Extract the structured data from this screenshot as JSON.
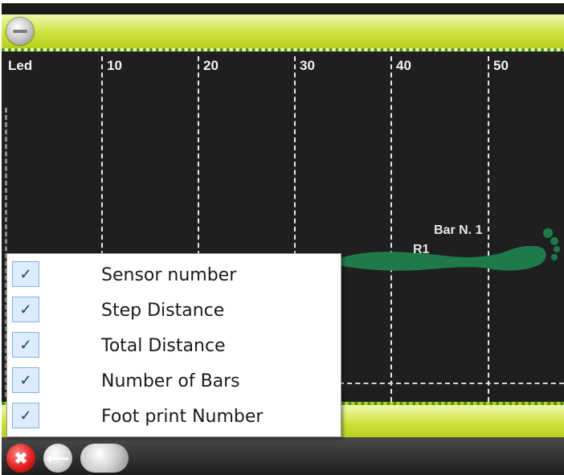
{
  "timeline": {
    "row_label": "Led",
    "ticks": [
      "10",
      "20",
      "30",
      "40",
      "50"
    ],
    "bar_label": "Bar N. 1",
    "footprint_label": "R1"
  },
  "menu": {
    "items": [
      {
        "label": "Sensor number",
        "checked": true
      },
      {
        "label": "Step Distance",
        "checked": true
      },
      {
        "label": "Total Distance",
        "checked": true
      },
      {
        "label": "Number of Bars",
        "checked": true
      },
      {
        "label": "Foot print Number",
        "checked": true
      }
    ]
  },
  "icons": {
    "top_button": "minus-icon",
    "close": "close-icon",
    "back": "arrow-left-icon",
    "blank": "blank-button-icon"
  },
  "colors": {
    "accent_yellow": "#cfe23f",
    "footprint_green": "#1f7a4a",
    "background": "#1f1f1f"
  }
}
